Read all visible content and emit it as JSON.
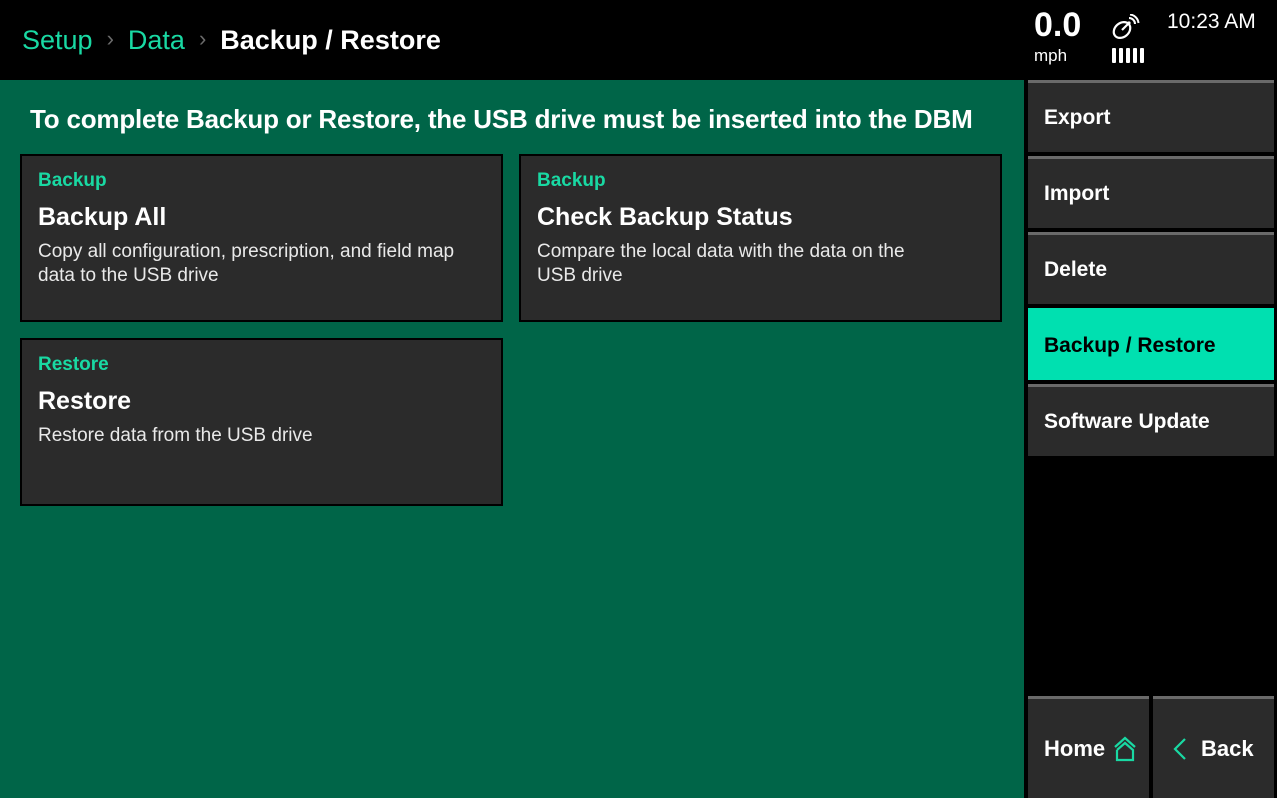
{
  "header": {
    "breadcrumb": [
      {
        "label": "Setup"
      },
      {
        "label": "Data"
      }
    ],
    "separator": "›",
    "current": "Backup / Restore",
    "speed": {
      "value": "0.0",
      "unit": "mph"
    },
    "gps": {
      "icon": "satellite-dish-icon",
      "signal_bars": 5
    },
    "time": "10:23 AM"
  },
  "main": {
    "notice": "To complete Backup or Restore, the USB drive must be inserted into the DBM",
    "cards": [
      {
        "category": "Backup",
        "title": "Backup All",
        "description": "Copy all configuration, prescription, and field map data to the USB drive"
      },
      {
        "category": "Backup",
        "title": "Check Backup Status",
        "description": "Compare the local data with the data on the USB drive"
      },
      {
        "category": "Restore",
        "title": "Restore",
        "description": "Restore data from the USB drive"
      }
    ]
  },
  "sidebar": {
    "items": [
      {
        "label": "Export",
        "active": false
      },
      {
        "label": "Import",
        "active": false
      },
      {
        "label": "Delete",
        "active": false
      },
      {
        "label": "Backup / Restore",
        "active": true
      },
      {
        "label": "Software Update",
        "active": false
      }
    ],
    "home_label": "Home",
    "back_label": "Back"
  },
  "colors": {
    "accent": "#19d9a3",
    "active_tab": "#00e0b0",
    "main_bg": "#006548",
    "card_bg": "#2b2b2b"
  }
}
